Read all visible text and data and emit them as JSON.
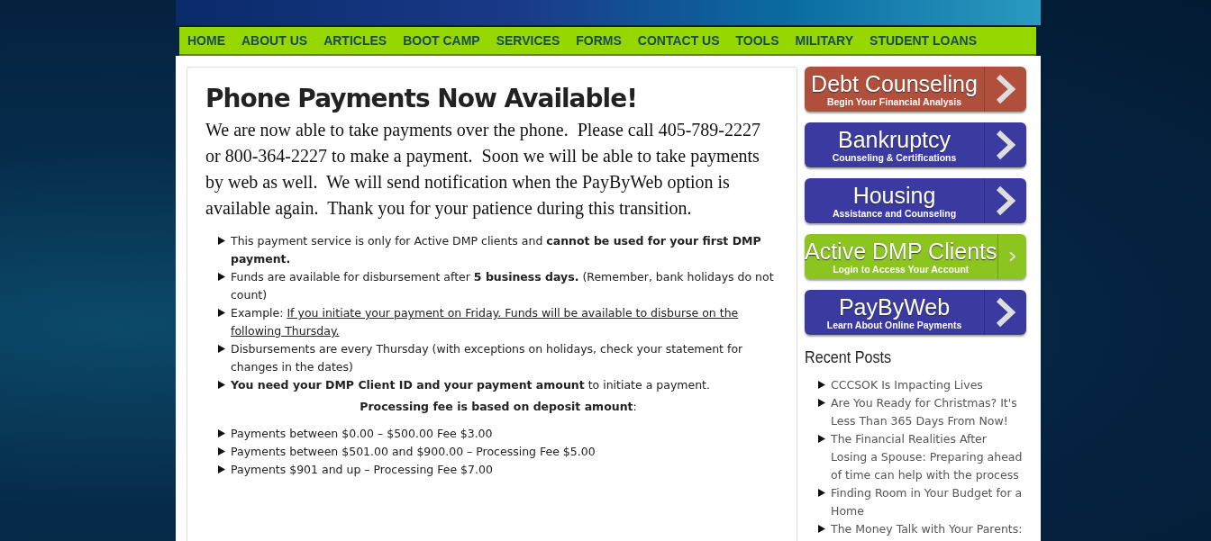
{
  "nav": {
    "items": [
      {
        "label": "HOME"
      },
      {
        "label": "ABOUT US"
      },
      {
        "label": "ARTICLES"
      },
      {
        "label": "BOOT CAMP"
      },
      {
        "label": "SERVICES"
      },
      {
        "label": "FORMS"
      },
      {
        "label": "CONTACT US"
      },
      {
        "label": "TOOLS"
      },
      {
        "label": "MILITARY"
      },
      {
        "label": "STUDENT LOANS"
      }
    ]
  },
  "article": {
    "title": "Phone Payments Now Available!",
    "intro": "We are now able to take payments over the phone.  Please call 405-789-2227 or 800-364-2227 to make a payment.  Soon we will be able to take payments by web as well.  We will send notification when the PayByWeb option is available again.  Thank you for your patience during this transition.",
    "notes": [
      {
        "text": "This payment service is only for Active DMP clients and **cannot be used for your first DMP payment.**"
      },
      {
        "text": "Funds are available for disbursement after **5 business days.** (Remember, bank holidays do not count)"
      },
      {
        "text": "Example: ",
        "link": "If you initiate your payment on Friday. Funds will be available to disburse on the following Thursday."
      },
      {
        "text": "Disbursements are every Thursday (with exceptions on holidays, check your statement for changes in the dates)"
      },
      {
        "text": "**You need your DMP Client ID and your payment amount** to initiate a payment."
      }
    ],
    "fee_heading": "**Processing fee is based on deposit amount**:",
    "fees": [
      {
        "text": "Payments between $0.00 – $500.00 Fee $3.00"
      },
      {
        "text": "Payments between $501.00 and $900.00 – Processing Fee $5.00"
      },
      {
        "text": "Payments $901 and up – Processing Fee $7.00"
      }
    ]
  },
  "sidebar": {
    "buttons": [
      {
        "title": "Debt Counseling",
        "subtitle": "Begin Your Financial Analysis",
        "color": "#b0503c"
      },
      {
        "title": "Bankruptcy",
        "subtitle": "Counseling & Certifications",
        "color": "#3a3aa0"
      },
      {
        "title": "Housing",
        "subtitle": "Assistance and Counseling",
        "color": "#3a3aa0"
      },
      {
        "title": "Active DMP Clients",
        "subtitle": "Login to Access Your Account",
        "color": "#8cc420"
      },
      {
        "title": "PayByWeb",
        "subtitle": "Learn About Online Payments",
        "color": "#3a3aa0"
      }
    ],
    "recent_title": "Recent Posts",
    "recent_posts": [
      {
        "label": "CCCSOK Is Impacting Lives"
      },
      {
        "label": "Are You Ready for Christmas? It's Less Than 365 Days From Now!"
      },
      {
        "label": "The Financial Realities After Losing a Spouse: Preparing ahead of time can help with the process"
      },
      {
        "label": "Finding Room in Your Budget for a Home"
      },
      {
        "label": "The Money Talk with Your Parents:"
      }
    ]
  }
}
